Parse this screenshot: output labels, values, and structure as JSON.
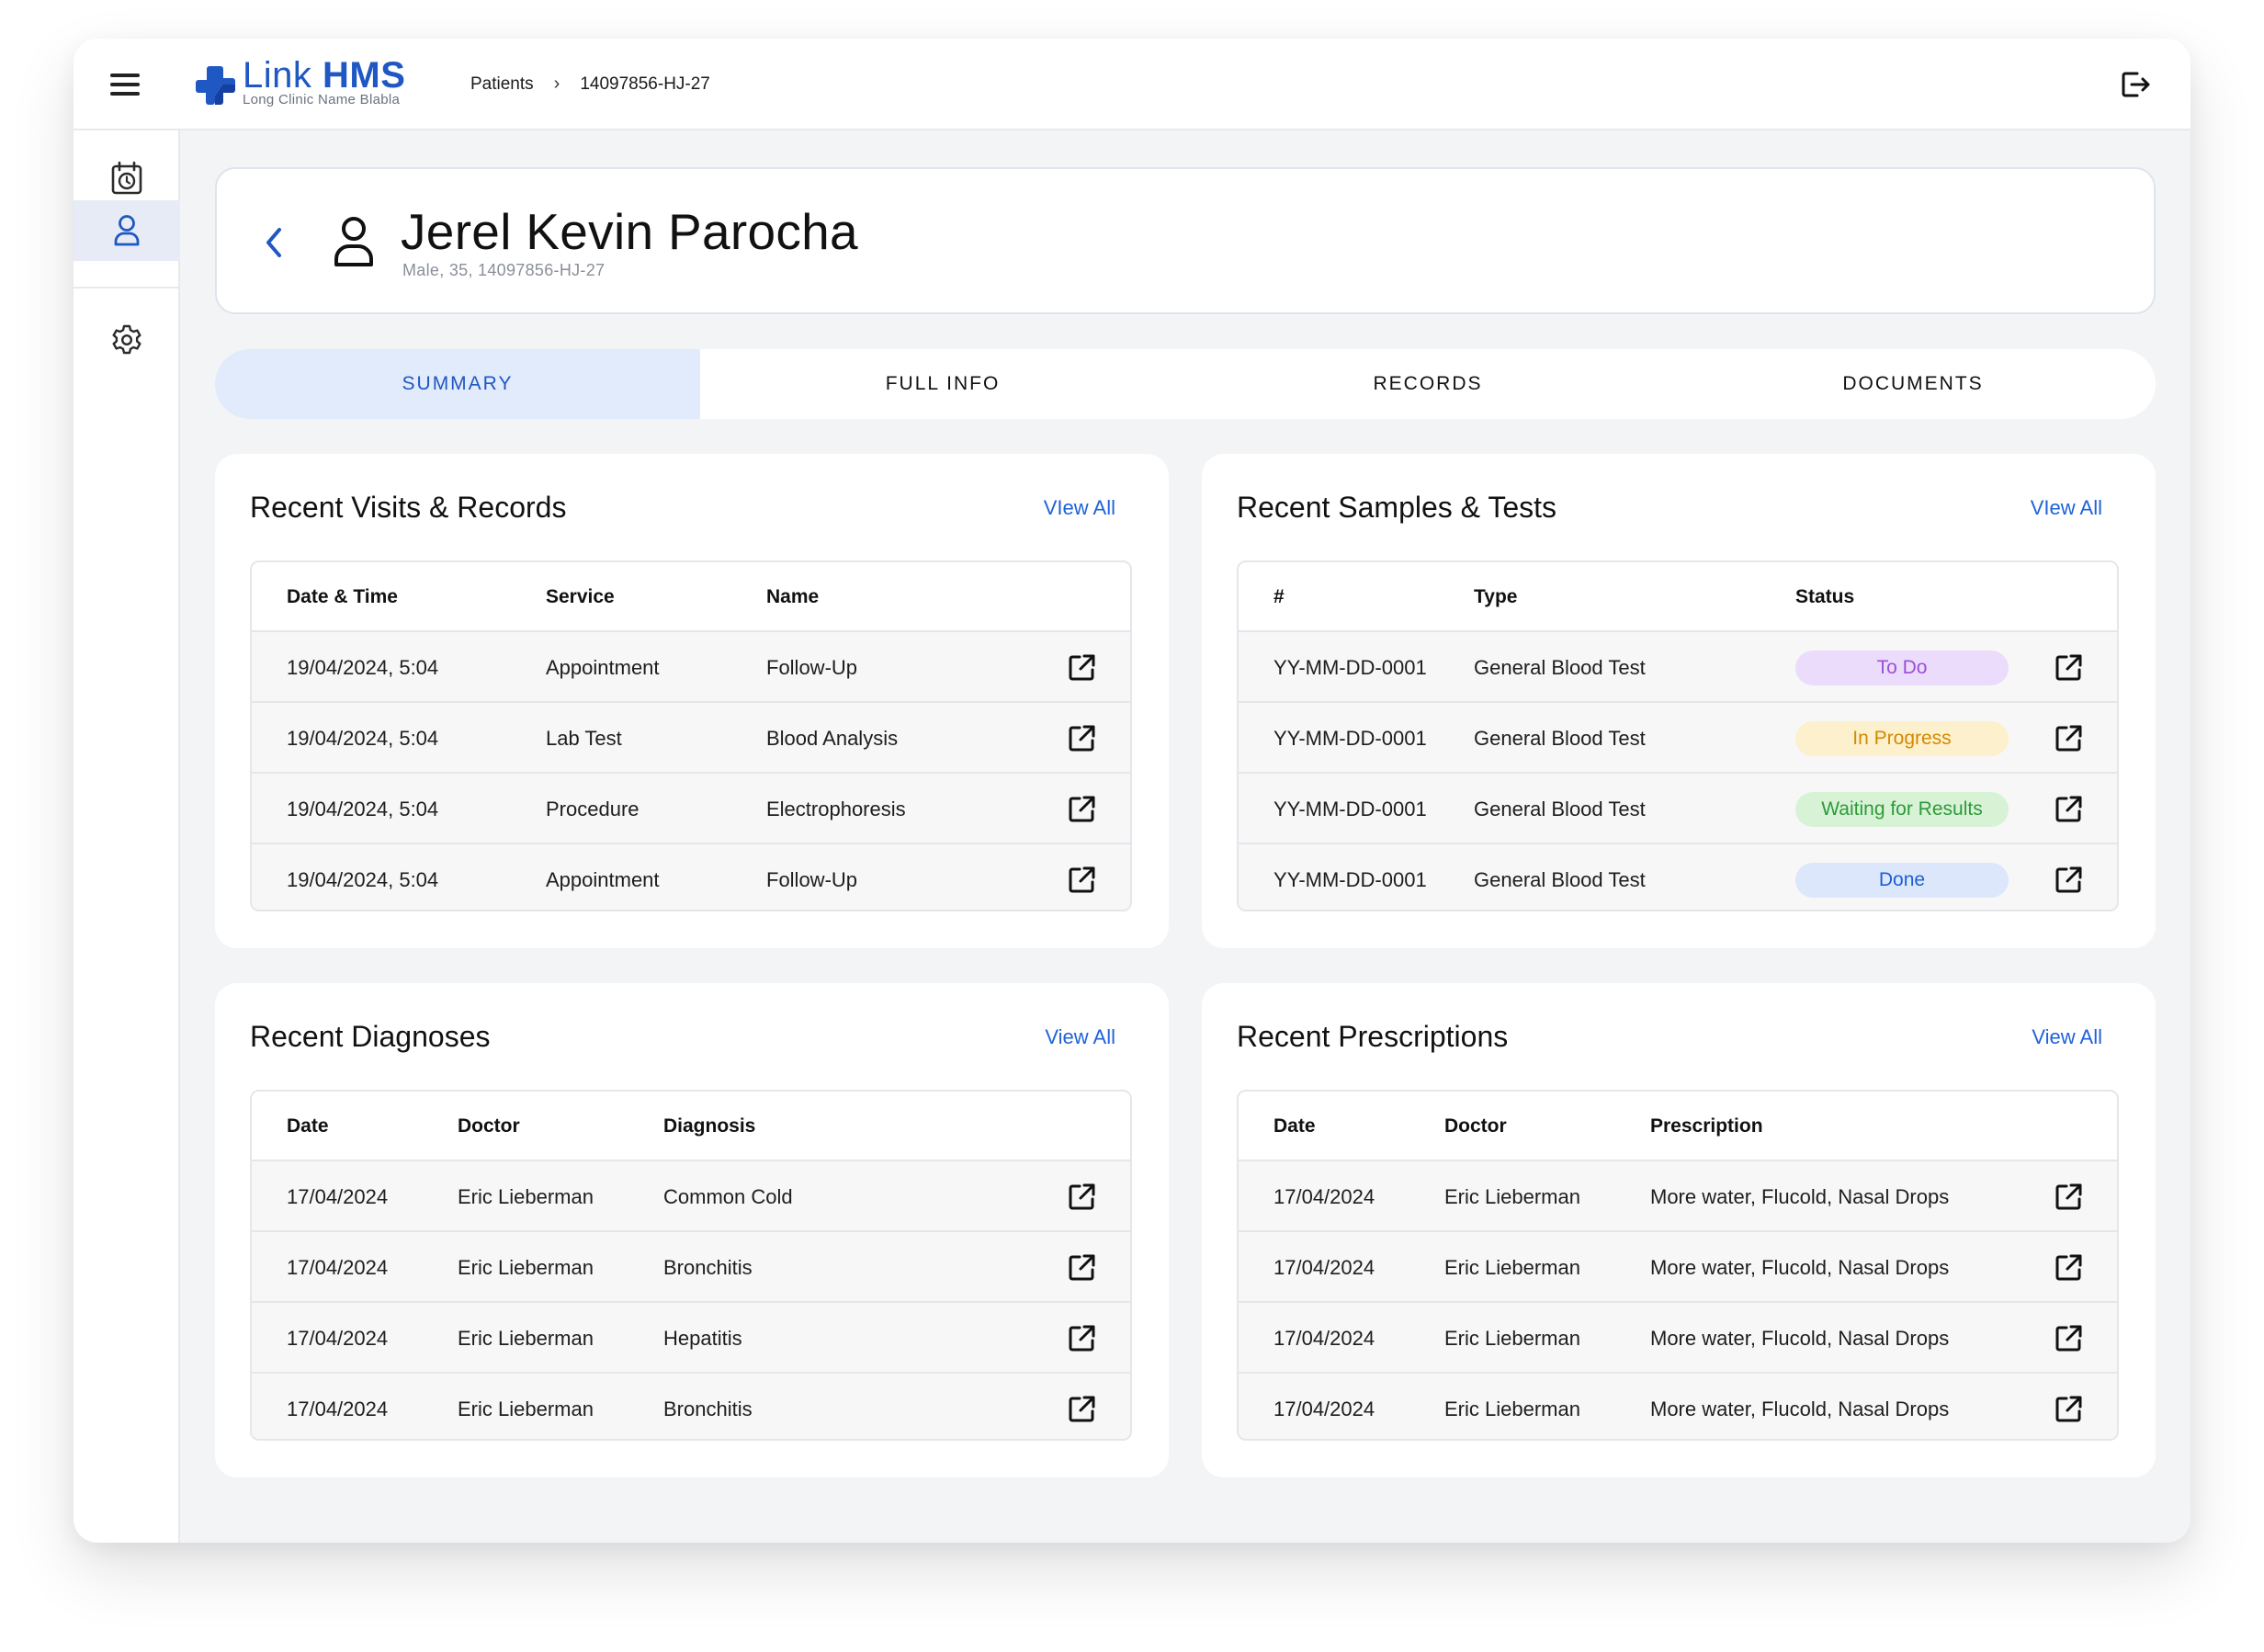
{
  "app": {
    "name_light": "Link",
    "name_bold": "HMS",
    "clinic_name": "Long Clinic Name Blabla"
  },
  "breadcrumb": [
    "Patients",
    "14097856-HJ-27"
  ],
  "patient": {
    "name": "Jerel Kevin Parocha",
    "meta": "Male, 35, 14097856-HJ-27"
  },
  "tabs": [
    {
      "label": "SUMMARY",
      "active": true
    },
    {
      "label": "FULL INFO",
      "active": false
    },
    {
      "label": "RECORDS",
      "active": false
    },
    {
      "label": "DOCUMENTS",
      "active": false
    }
  ],
  "colors": {
    "accent": "#1f57c3",
    "todo_bg": "#ecdcfb",
    "todo_fg": "#9b4fd9",
    "progress_bg": "#fdf0cc",
    "progress_fg": "#d28a00",
    "waiting_bg": "#d8f2d6",
    "waiting_fg": "#2e9a3a",
    "done_bg": "#dce7fb",
    "done_fg": "#1f5fd0"
  },
  "visits": {
    "title": "Recent Visits & Records",
    "view_all": "VIew All",
    "headers": [
      "Date & Time",
      "Service",
      "Name"
    ],
    "rows": [
      [
        "19/04/2024, 5:04",
        "Appointment",
        "Follow-Up"
      ],
      [
        "19/04/2024, 5:04",
        "Lab Test",
        "Blood Analysis"
      ],
      [
        "19/04/2024, 5:04",
        "Procedure",
        "Electrophoresis"
      ],
      [
        "19/04/2024, 5:04",
        "Appointment",
        "Follow-Up"
      ]
    ]
  },
  "samples": {
    "title": "Recent Samples & Tests",
    "view_all": "VIew All",
    "headers": [
      "#",
      "Type",
      "Status"
    ],
    "rows": [
      [
        "YY-MM-DD-0001",
        "General Blood Test",
        "To Do"
      ],
      [
        "YY-MM-DD-0001",
        "General Blood Test",
        "In Progress"
      ],
      [
        "YY-MM-DD-0001",
        "General Blood Test",
        "Waiting for Results"
      ],
      [
        "YY-MM-DD-0001",
        "General Blood Test",
        "Done"
      ]
    ]
  },
  "diagnoses": {
    "title": "Recent Diagnoses",
    "view_all": "View All",
    "headers": [
      "Date",
      "Doctor",
      "Diagnosis"
    ],
    "rows": [
      [
        "17/04/2024",
        "Eric Lieberman",
        "Common Cold"
      ],
      [
        "17/04/2024",
        "Eric Lieberman",
        "Bronchitis"
      ],
      [
        "17/04/2024",
        "Eric Lieberman",
        "Hepatitis"
      ],
      [
        "17/04/2024",
        "Eric Lieberman",
        "Bronchitis"
      ]
    ]
  },
  "prescriptions": {
    "title": "Recent Prescriptions",
    "view_all": "View All",
    "headers": [
      "Date",
      "Doctor",
      "Prescription"
    ],
    "rows": [
      [
        "17/04/2024",
        "Eric Lieberman",
        "More water, Flucold, Nasal Drops"
      ],
      [
        "17/04/2024",
        "Eric Lieberman",
        "More water, Flucold, Nasal Drops"
      ],
      [
        "17/04/2024",
        "Eric Lieberman",
        "More water, Flucold, Nasal Drops"
      ],
      [
        "17/04/2024",
        "Eric Lieberman",
        "More water, Flucold, Nasal Drops"
      ]
    ]
  }
}
